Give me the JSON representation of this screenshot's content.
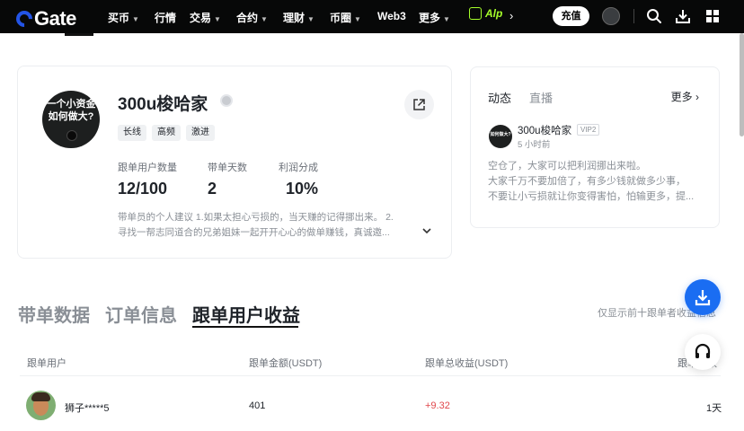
{
  "nav": {
    "logo": "Gate",
    "items": [
      {
        "label": "买币",
        "caret": true
      },
      {
        "label": "行情",
        "caret": false
      },
      {
        "label": "交易",
        "caret": true
      },
      {
        "label": "合约",
        "caret": true
      },
      {
        "label": "理财",
        "caret": true
      },
      {
        "label": "币圈",
        "caret": true
      },
      {
        "label": "Web3",
        "caret": false
      },
      {
        "label": "更多",
        "caret": true
      }
    ],
    "ai_label": "Alp",
    "deposit": "充值",
    "icons": [
      "search-icon",
      "download-icon",
      "grid-apps-icon"
    ]
  },
  "trader": {
    "avatar_text": "一个小资金\n如何做大?",
    "name": "300u梭哈家",
    "tags": [
      "长线",
      "高频",
      "激进"
    ],
    "stats": [
      {
        "label": "跟单用户数量",
        "value": "12/100"
      },
      {
        "label": "带单天数",
        "value": "2"
      },
      {
        "label": "利润分成",
        "value": "10%"
      }
    ],
    "bio_line1": "带单员的个人建议 1.如果太担心亏损的，当天赚的记得挪出来。 2.",
    "bio_line2": "寻找一帮志同道合的兄弟姐妹一起开开心心的做单赚钱，真诚邀..."
  },
  "feed": {
    "tabs": [
      "动态",
      "直播"
    ],
    "more": "更多",
    "post": {
      "avatar_text": "如何做大?",
      "author": "300u梭哈家",
      "vip": "VIP2",
      "time": "5 小时前",
      "lines": [
        "空仓了，大家可以把利润挪出来啦。",
        "大家千万不要加倍了，有多少钱就做多少事，",
        "不要让小亏损就让你变得害怕，怕输更多，提..."
      ]
    }
  },
  "sections": {
    "tabs": [
      "带单数据",
      "订单信息",
      "跟单用户收益"
    ],
    "active": 2,
    "note": "仅显示前十跟单者收益信息"
  },
  "table": {
    "headers": [
      "跟单用户",
      "跟单金额(USDT)",
      "跟单总收益(USDT)",
      "跟单天数"
    ],
    "rows": [
      {
        "user": "狮子*****5",
        "amount": "401",
        "profit": "+9.32",
        "days": "1天"
      }
    ]
  },
  "colors": {
    "nav_bg": "#070808",
    "accent_blue": "#1a6df2",
    "ai_green": "#a6ff2a",
    "profit_red": "#e0474b"
  }
}
